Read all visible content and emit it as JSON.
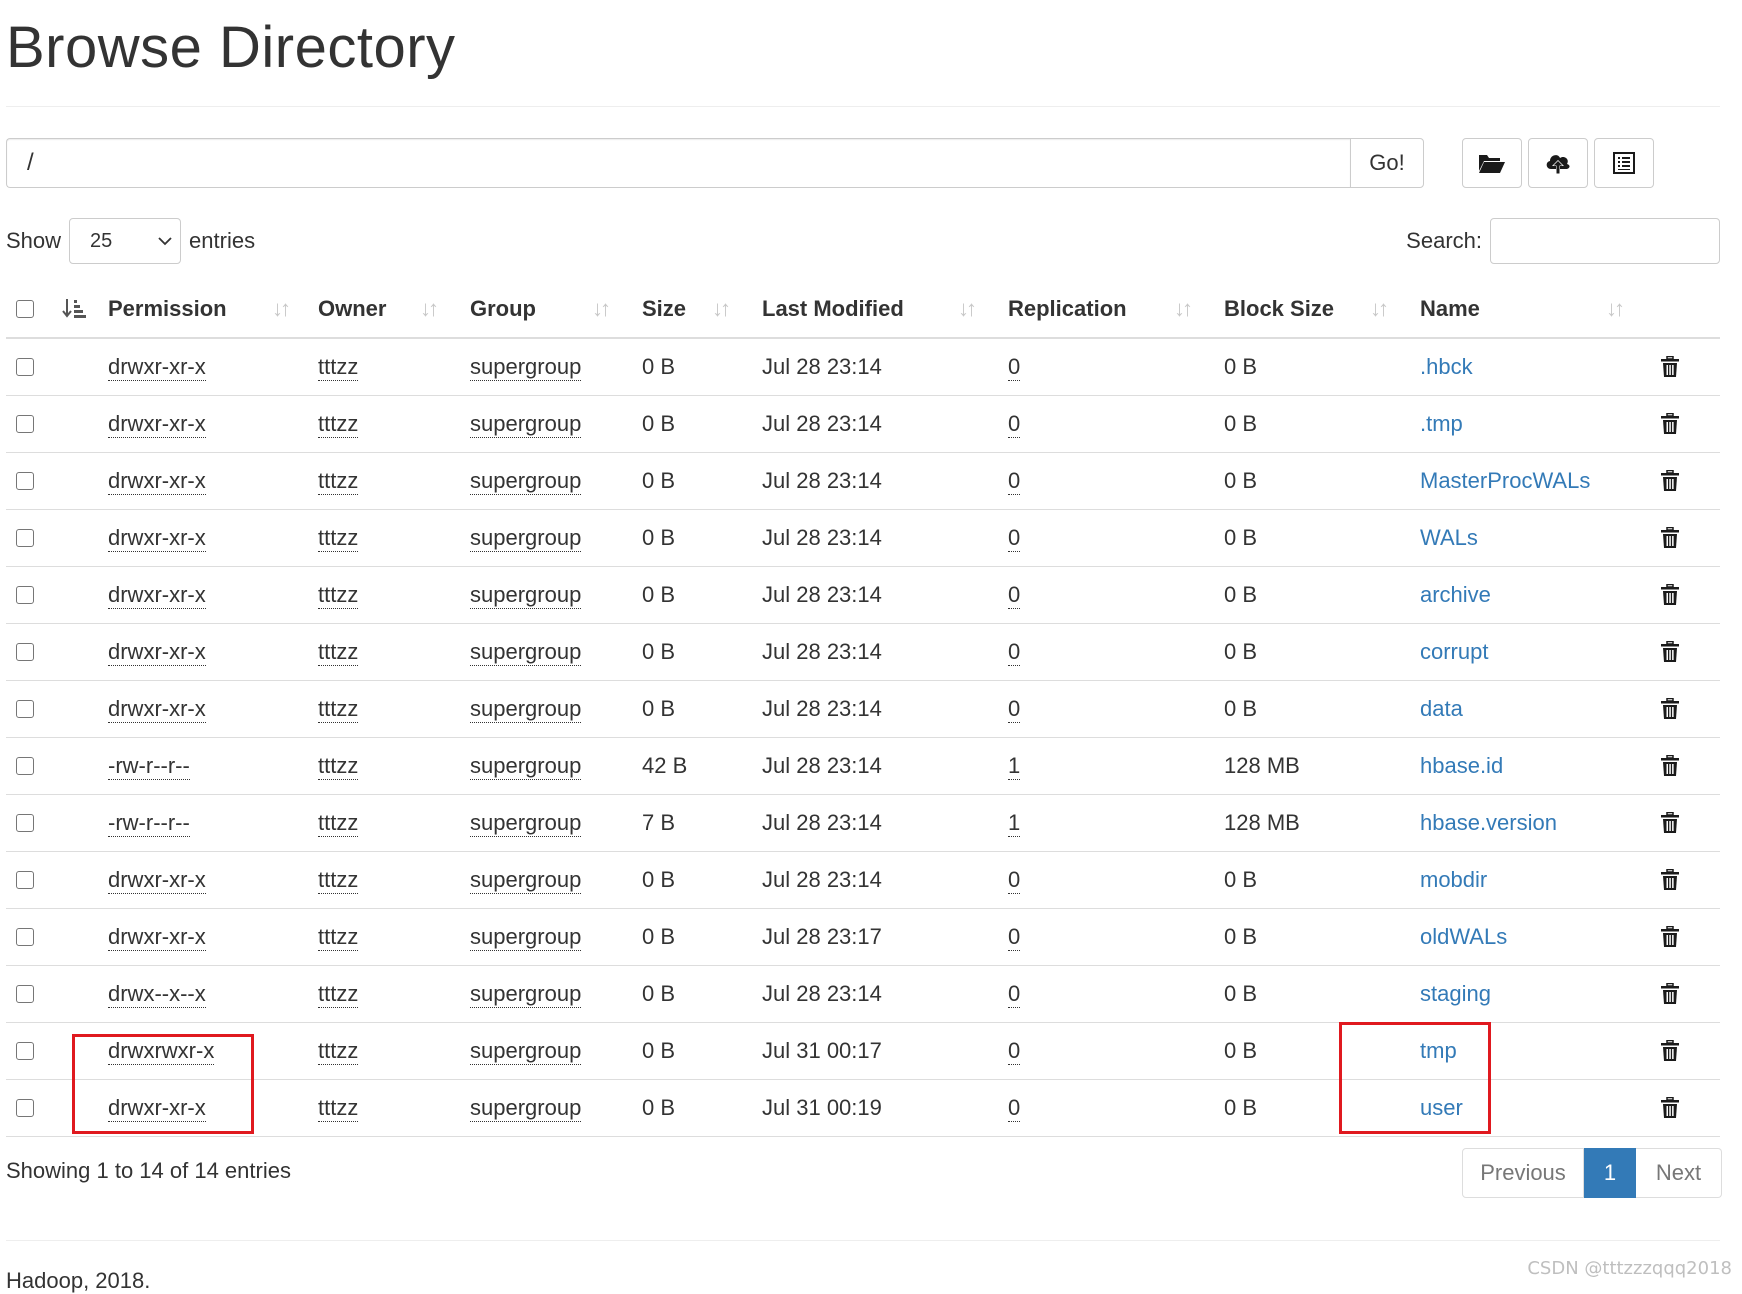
{
  "page": {
    "title": "Browse Directory"
  },
  "path_bar": {
    "value": "/",
    "go_label": "Go!"
  },
  "toolbar": {
    "create_directory_icon": "folder-open-icon",
    "upload_icon": "cloud-upload-icon",
    "cut_paste_icon": "list-alt-icon"
  },
  "show_entries": {
    "show_label": "Show",
    "selected": "25",
    "entries_label": "entries"
  },
  "search": {
    "label": "Search:",
    "value": ""
  },
  "table": {
    "headers": {
      "permission": "Permission",
      "owner": "Owner",
      "group": "Group",
      "size": "Size",
      "last_modified": "Last Modified",
      "replication": "Replication",
      "block_size": "Block Size",
      "name": "Name"
    },
    "rows": [
      {
        "permission": "drwxr-xr-x",
        "owner": "tttzz",
        "group": "supergroup",
        "size": "0 B",
        "last_modified": "Jul 28 23:14",
        "replication": "0",
        "block_size": "0 B",
        "name": ".hbck"
      },
      {
        "permission": "drwxr-xr-x",
        "owner": "tttzz",
        "group": "supergroup",
        "size": "0 B",
        "last_modified": "Jul 28 23:14",
        "replication": "0",
        "block_size": "0 B",
        "name": ".tmp"
      },
      {
        "permission": "drwxr-xr-x",
        "owner": "tttzz",
        "group": "supergroup",
        "size": "0 B",
        "last_modified": "Jul 28 23:14",
        "replication": "0",
        "block_size": "0 B",
        "name": "MasterProcWALs"
      },
      {
        "permission": "drwxr-xr-x",
        "owner": "tttzz",
        "group": "supergroup",
        "size": "0 B",
        "last_modified": "Jul 28 23:14",
        "replication": "0",
        "block_size": "0 B",
        "name": "WALs"
      },
      {
        "permission": "drwxr-xr-x",
        "owner": "tttzz",
        "group": "supergroup",
        "size": "0 B",
        "last_modified": "Jul 28 23:14",
        "replication": "0",
        "block_size": "0 B",
        "name": "archive"
      },
      {
        "permission": "drwxr-xr-x",
        "owner": "tttzz",
        "group": "supergroup",
        "size": "0 B",
        "last_modified": "Jul 28 23:14",
        "replication": "0",
        "block_size": "0 B",
        "name": "corrupt"
      },
      {
        "permission": "drwxr-xr-x",
        "owner": "tttzz",
        "group": "supergroup",
        "size": "0 B",
        "last_modified": "Jul 28 23:14",
        "replication": "0",
        "block_size": "0 B",
        "name": "data"
      },
      {
        "permission": "-rw-r--r--",
        "owner": "tttzz",
        "group": "supergroup",
        "size": "42 B",
        "last_modified": "Jul 28 23:14",
        "replication": "1",
        "block_size": "128 MB",
        "name": "hbase.id"
      },
      {
        "permission": "-rw-r--r--",
        "owner": "tttzz",
        "group": "supergroup",
        "size": "7 B",
        "last_modified": "Jul 28 23:14",
        "replication": "1",
        "block_size": "128 MB",
        "name": "hbase.version"
      },
      {
        "permission": "drwxr-xr-x",
        "owner": "tttzz",
        "group": "supergroup",
        "size": "0 B",
        "last_modified": "Jul 28 23:14",
        "replication": "0",
        "block_size": "0 B",
        "name": "mobdir"
      },
      {
        "permission": "drwxr-xr-x",
        "owner": "tttzz",
        "group": "supergroup",
        "size": "0 B",
        "last_modified": "Jul 28 23:17",
        "replication": "0",
        "block_size": "0 B",
        "name": "oldWALs"
      },
      {
        "permission": "drwx--x--x",
        "owner": "tttzz",
        "group": "supergroup",
        "size": "0 B",
        "last_modified": "Jul 28 23:14",
        "replication": "0",
        "block_size": "0 B",
        "name": "staging"
      },
      {
        "permission": "drwxrwxr-x",
        "owner": "tttzz",
        "group": "supergroup",
        "size": "0 B",
        "last_modified": "Jul 31 00:17",
        "replication": "0",
        "block_size": "0 B",
        "name": "tmp"
      },
      {
        "permission": "drwxr-xr-x",
        "owner": "tttzz",
        "group": "supergroup",
        "size": "0 B",
        "last_modified": "Jul 31 00:19",
        "replication": "0",
        "block_size": "0 B",
        "name": "user"
      }
    ]
  },
  "info": "Showing 1 to 14 of 14 entries",
  "pagination": {
    "previous": "Previous",
    "current": "1",
    "next": "Next"
  },
  "footer": "Hadoop, 2018.",
  "watermark": "CSDN @tttzzzqqq2018",
  "colors": {
    "link": "#337ab7",
    "annotation": "#e0191f",
    "active_page": "#337ab7"
  }
}
